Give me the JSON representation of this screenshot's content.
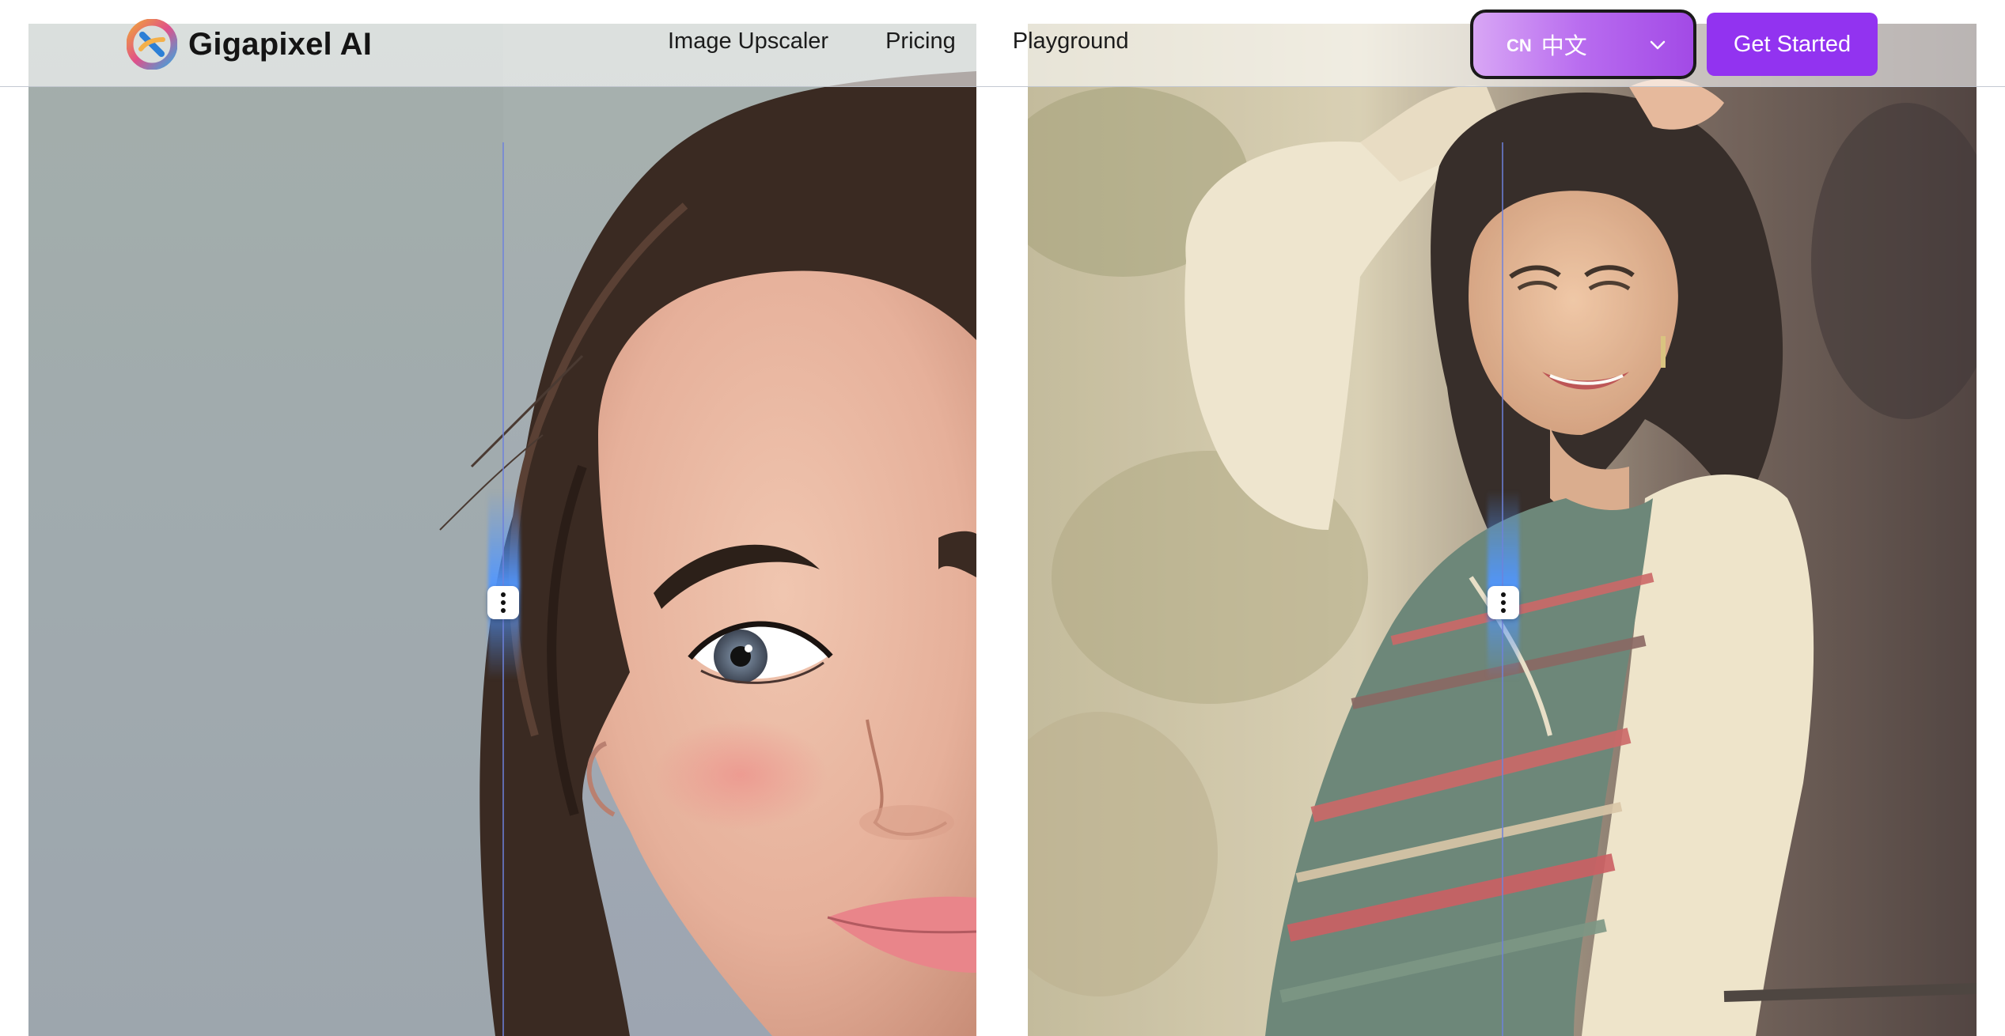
{
  "brand": {
    "name": "Gigapixel AI",
    "logo_icon": "gigapixel-logo-icon"
  },
  "nav": {
    "items": [
      {
        "label": "Image Upscaler"
      },
      {
        "label": "Pricing"
      },
      {
        "label": "Playground"
      }
    ]
  },
  "language": {
    "flag": "CN",
    "label": "中文",
    "icon": "chevron-down-icon"
  },
  "cta": {
    "label": "Get Started"
  },
  "comparisons": [
    {
      "name": "portrait-woman-blue-eyes",
      "slider_position_fraction": 0.5
    },
    {
      "name": "vintage-woman-photo",
      "slider_position_fraction": 0.5
    }
  ],
  "colors": {
    "accent": "#9233f0",
    "language_gradient_start": "#d8a6f5",
    "language_gradient_end": "#a24ae6",
    "divider": "#6e82dc"
  }
}
